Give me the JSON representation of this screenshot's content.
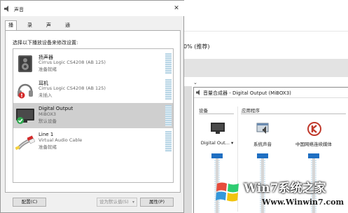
{
  "background": {
    "value_text": "0% (推荐)"
  },
  "dialog": {
    "title": "声音",
    "close_glyph": "✕",
    "tabs": [
      {
        "label": "播放",
        "active": true
      },
      {
        "label": "录制",
        "active": false
      },
      {
        "label": "声音",
        "active": false
      },
      {
        "label": "通信",
        "active": false
      }
    ],
    "instruction": "选择以下播放设备来修改设置:",
    "devices": [
      {
        "name": "扬声器",
        "subtitle": "Cirrus Logic CS4208 (AB 125)",
        "status": "准备就绪",
        "icon": "speaker-icon",
        "selected": false
      },
      {
        "name": "耳机",
        "subtitle": "Cirrus Logic CS4208 (AB 125)",
        "status": "未插入",
        "icon": "headphones-icon",
        "selected": false
      },
      {
        "name": "Digital Output",
        "subtitle": "MiBOX3",
        "status": "默认设备",
        "icon": "monitor-icon",
        "selected": true
      },
      {
        "name": "Line 1",
        "subtitle": "Virtual Audio Cable",
        "status": "准备就绪",
        "icon": "cable-icon",
        "selected": false
      }
    ],
    "buttons": {
      "configure": "配置(C)",
      "set_default": "设为默认值(S)",
      "properties": "属性(P)"
    }
  },
  "mixer": {
    "title": "音量合成器 - Digital Output (MiBOX3)",
    "device_section": "设备",
    "apps_section": "应用程序",
    "columns": [
      {
        "label": "Digital Out...",
        "icon": "monitor-icon",
        "has_dropdown": true
      },
      {
        "label": "系统声音",
        "icon": "system-sounds-icon",
        "has_dropdown": false
      },
      {
        "label": "中国网络连续媒体",
        "icon": "cntv-app-icon",
        "has_dropdown": false
      }
    ]
  },
  "watermark": {
    "brand": "Win7系统之家",
    "url": "Www.Winwin7.com"
  },
  "colors": {
    "accent": "#1f6fc2",
    "selection": "#cfcfcf",
    "check": "#2fa84f"
  }
}
